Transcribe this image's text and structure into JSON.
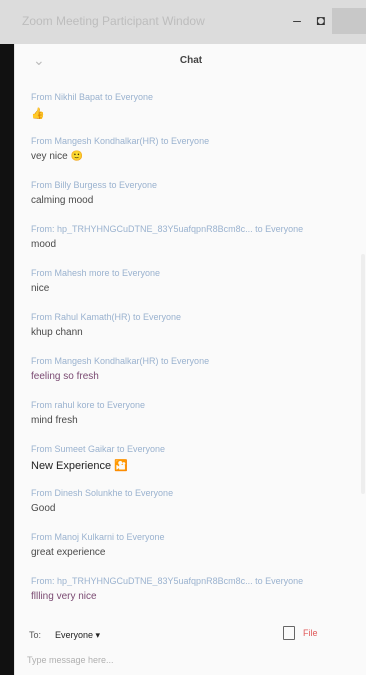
{
  "window": {
    "title": "Zoom Meeting Participant Window"
  },
  "chat": {
    "title": "Chat",
    "messages": [
      {
        "from": "From Nikhil Bapat to Everyone",
        "text": "👍"
      },
      {
        "from": "From Mangesh Kondhalkar(HR) to Everyone",
        "text": "vey nice 🙂"
      },
      {
        "from": "From Billy Burgess to Everyone",
        "text": "calming mood"
      },
      {
        "from": "From: hp_TRHYHNGCuDTNE_83Y5uafqpnR8Bcm8c... to Everyone",
        "text": "mood"
      },
      {
        "from": "From Mahesh more to Everyone",
        "text": "nice"
      },
      {
        "from": "From Rahul Kamath(HR) to Everyone",
        "text": "khup chann"
      },
      {
        "from": "From Mangesh Kondhalkar(HR) to Everyone",
        "text": "feeling so fresh"
      },
      {
        "from": "From rahul kore to Everyone",
        "text": "mind fresh"
      },
      {
        "from": "From Sumeet Gaikar to Everyone",
        "text": "New Experience 🎦"
      },
      {
        "from": "From Dinesh Solunkhe to Everyone",
        "text": "Good"
      },
      {
        "from": "From Manoj Kulkarni to Everyone",
        "text": "great experience"
      },
      {
        "from": "From: hp_TRHYHNGCuDTNE_83Y5uafqpnR8Bcm8c... to Everyone",
        "text": "fllling very nice"
      }
    ]
  },
  "footer": {
    "to_label": "To:",
    "to_value": "Everyone ▾",
    "file_label": "File",
    "input_placeholder": "Type message here..."
  }
}
